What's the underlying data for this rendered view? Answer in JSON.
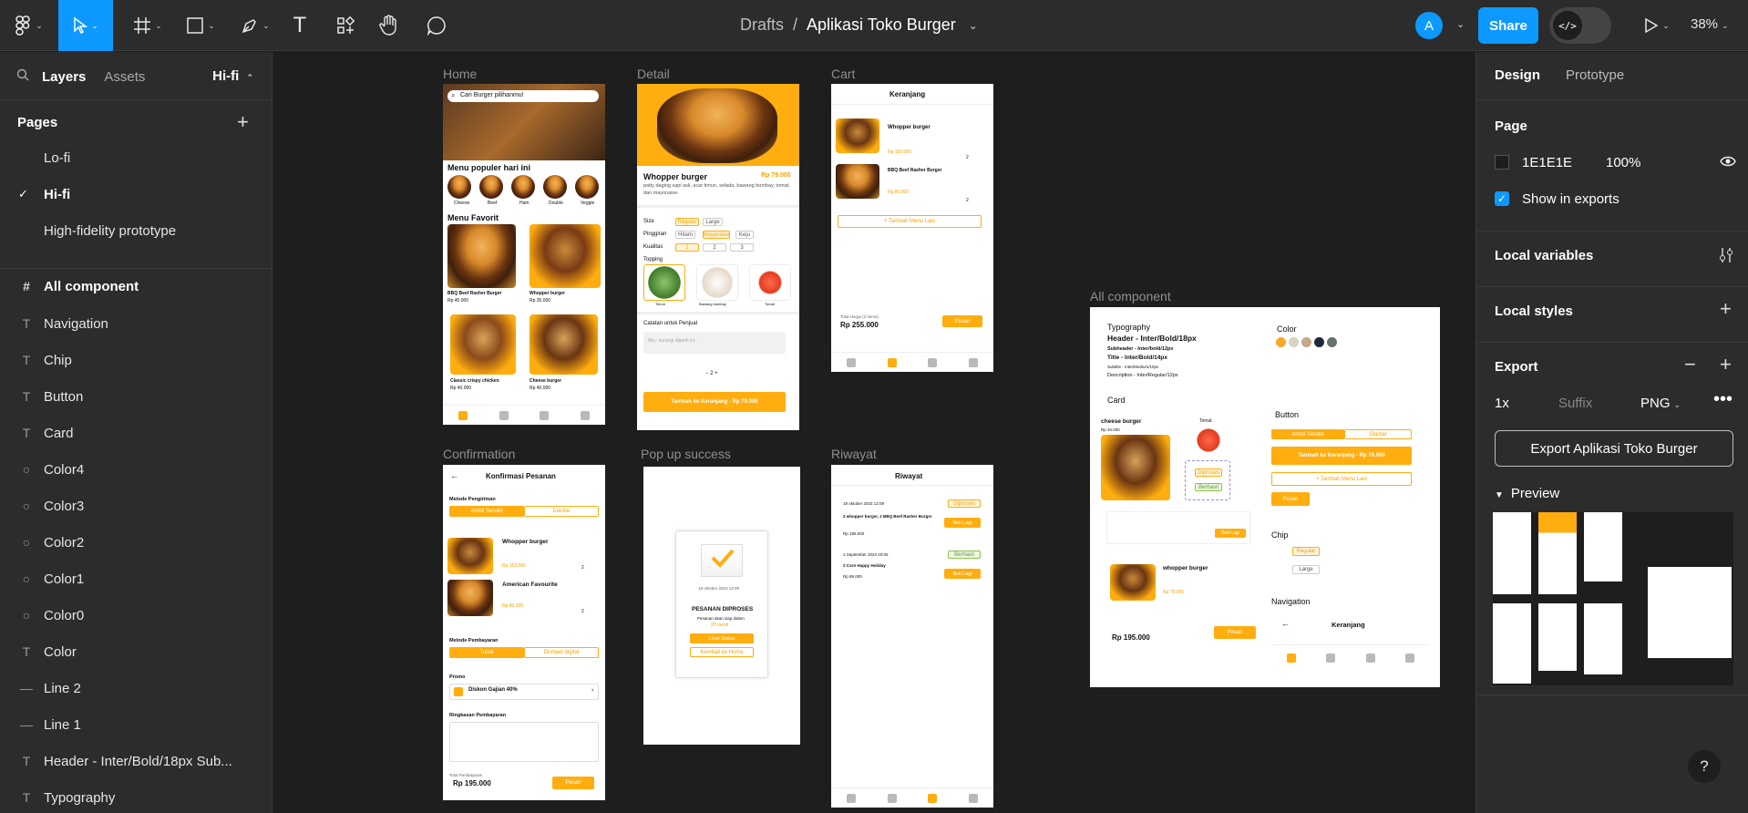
{
  "app": {
    "breadcrumb": "Drafts",
    "separator": "/",
    "project_title": "Aplikasi Toko Burger",
    "avatar_initial": "A",
    "share_label": "Share",
    "dev_mode_glyph": "</>",
    "zoom": "38%"
  },
  "toolbar": {
    "icons": [
      "figma-menu-icon",
      "move-tool-icon",
      "frame-tool-icon",
      "shape-tool-icon",
      "pen-tool-icon",
      "text-tool-icon",
      "component-tool-icon",
      "hand-tool-icon",
      "comment-tool-icon"
    ]
  },
  "left_panel": {
    "tabs": [
      "Layers",
      "Assets"
    ],
    "current_page": "Hi-fi",
    "pages_heading": "Pages",
    "pages": [
      {
        "label": "Lo-fi",
        "active": false
      },
      {
        "label": "Hi-fi",
        "active": true
      },
      {
        "label": "High-fidelity prototype",
        "active": false
      }
    ],
    "frame_name": "All component",
    "layers": [
      {
        "icon": "text-layer-icon",
        "glyph": "T",
        "label": "Navigation"
      },
      {
        "icon": "text-layer-icon",
        "glyph": "T",
        "label": "Chip"
      },
      {
        "icon": "text-layer-icon",
        "glyph": "T",
        "label": "Button"
      },
      {
        "icon": "text-layer-icon",
        "glyph": "T",
        "label": "Card"
      },
      {
        "icon": "ellipse-layer-icon",
        "glyph": "○",
        "label": "Color4"
      },
      {
        "icon": "ellipse-layer-icon",
        "glyph": "○",
        "label": "Color3"
      },
      {
        "icon": "ellipse-layer-icon",
        "glyph": "○",
        "label": "Color2"
      },
      {
        "icon": "ellipse-layer-icon",
        "glyph": "○",
        "label": "Color1"
      },
      {
        "icon": "ellipse-layer-icon",
        "glyph": "○",
        "label": "Color0"
      },
      {
        "icon": "text-layer-icon",
        "glyph": "T",
        "label": "Color"
      },
      {
        "icon": "line-layer-icon",
        "glyph": "—",
        "label": "Line 2"
      },
      {
        "icon": "line-layer-icon",
        "glyph": "—",
        "label": "Line 1"
      },
      {
        "icon": "text-layer-icon",
        "glyph": "T",
        "label": "Header - Inter/Bold/18px Sub..."
      },
      {
        "icon": "text-layer-icon",
        "glyph": "T",
        "label": "Typography"
      }
    ]
  },
  "right_panel": {
    "tabs": [
      "Design",
      "Prototype"
    ],
    "page_heading": "Page",
    "page_color": "1E1E1E",
    "page_opacity": "100%",
    "show_in_exports": "Show in exports",
    "local_variables": "Local variables",
    "local_styles": "Local styles",
    "export_heading": "Export",
    "export_scale": "1x",
    "export_suffix_placeholder": "Suffix",
    "export_format": "PNG",
    "export_button": "Export Aplikasi Toko Burger",
    "preview_heading": "Preview"
  },
  "canvas": {
    "frames": {
      "home": "Home",
      "detail": "Detail",
      "cart": "Cart",
      "confirmation": "Confirmation",
      "popup": "Pop up success",
      "riwayat": "Riwayat",
      "all_component": "All component"
    },
    "home_screen": {
      "search": "Cari Burger pilihanmu!",
      "popular": "Menu populer hari ini",
      "chips": [
        "Cheese",
        "Beef",
        "Ham",
        "Double",
        "Veggie"
      ],
      "favorites": "Menu Favorit",
      "items": [
        {
          "name": "BBQ Beef Rasher Burger",
          "price": "Rp 45.000"
        },
        {
          "name": "Whopper burger",
          "price": "Rp 35.000"
        },
        {
          "name": "Classic crispy chicken",
          "price": "Rp 40.000"
        },
        {
          "name": "Cheese burger",
          "price": "Rp 40.000"
        }
      ]
    },
    "detail_screen": {
      "name": "Whopper burger",
      "price": "Rp 79.000",
      "desc": "patty daging sapi asli, acar timun, selada, bawang bombay, tomat, dan mayonaise.",
      "size": "Size",
      "size_opts": [
        "Regular",
        "Large"
      ],
      "pinggiran": "Pinggiran",
      "ping_opts": [
        "Hitam",
        "Mayonaise",
        "Keju"
      ],
      "kualitas": "Kualitas",
      "qty_opts": [
        "1",
        "2",
        "3"
      ],
      "topping": "Topping",
      "toppings": [
        "Timun",
        "Bawang bombay",
        "Tomat"
      ],
      "note_label": "Catatan untuk Penjual",
      "note_placeholder": "Mis.: kurangi diganti ini...",
      "qty": "2",
      "cta": "Tambah ke Keranjang - Rp 79.000"
    },
    "cart_screen": {
      "title": "Keranjang",
      "items": [
        {
          "name": "Whopper burger",
          "price": "Rp 153.000",
          "qty": "2"
        },
        {
          "name": "BBQ Beef Rasher Burger",
          "price": "Rp 80.000",
          "qty": "2"
        }
      ],
      "add_more": "+ Tambah Menu Lain",
      "total_label": "Total Harga (2 items)",
      "total": "Rp 255.000",
      "order": "Pesan"
    },
    "confirm_screen": {
      "title": "Konfirmasi Pesanan",
      "method": "Metode Pengiriman",
      "opts": [
        "Ambil Sendiri",
        "Diantar"
      ],
      "items": [
        {
          "name": "Whopper burger",
          "price": "Rp 153.000",
          "qty": "2"
        },
        {
          "name": "American Favourite",
          "price": "Rp 80.000",
          "qty": "2"
        }
      ],
      "pay": "Metode Pembayaran",
      "pay_opts": [
        "Tunai",
        "Dompet digital"
      ],
      "promo": "Promo",
      "promo_name": "Diskon Gajian 40%",
      "summary": "Ringkasan Pembayaran",
      "total_label": "Total Pembayaran",
      "total": "Rp 195.000",
      "order": "Pesan"
    },
    "popup_screen": {
      "date": "19 oktober 2023 12:09",
      "status": "PESANAN DIPROSES",
      "eta": "Pesanan akan siap dalam",
      "eta_value": "20 menit",
      "btn1": "Lihat Status",
      "btn2": "Kembali ke Home"
    },
    "riwayat_screen": {
      "title": "Riwayat",
      "entries": [
        {
          "date": "19 oktober 2023 12:09",
          "status": "Diproses",
          "desc": "2 whopper burger, 2 BBQ Beef Rasher Burger",
          "price": "Rp 195.000",
          "btn": "Beli Lagi"
        },
        {
          "date": "1 September 2023 20:05",
          "status": "Berhasil",
          "desc": "2 Corn Happy Holiday",
          "price": "Rp 88.000",
          "btn": "Beli Lagi"
        }
      ]
    },
    "component_screen": {
      "typography": "Typography",
      "header": "Header - Inter/Bold/18px",
      "subheader": "Subheader - Inter/bold/12px",
      "titlestyle": "Title - Inter/Bold/14px",
      "subtitle": "Subtitle - Inter/Medium/10px",
      "desc": "Description - Inter/Regular/12px",
      "color": "Color",
      "colors": [
        "#f9a825",
        "#d9d2c5",
        "#c4a888",
        "#1e2a38",
        "#66726a"
      ],
      "card": "Card",
      "card_item": "cheese burger",
      "card_price": "Rp 40.000",
      "tomat": "Tomat",
      "button": "Button",
      "btn_opts": [
        "Ambil Sendiri",
        "Diantar"
      ],
      "btn_cta": "Tambah ke Keranjang - Rp 79.000",
      "btn_add": "+ Tambah Menu Lain",
      "btn_order": "Pesan",
      "chip": "Chip",
      "chip_opts": [
        "Regular",
        "Large"
      ],
      "navigation": "Navigation",
      "nav_title": "Keranjang",
      "total": "Rp 195.000",
      "diproses": "Diproses",
      "berhasil": "Berhasil",
      "beli": "Beli Lagi",
      "whopper": "whopper burger",
      "whopper_price": "Rp 79.000"
    }
  }
}
